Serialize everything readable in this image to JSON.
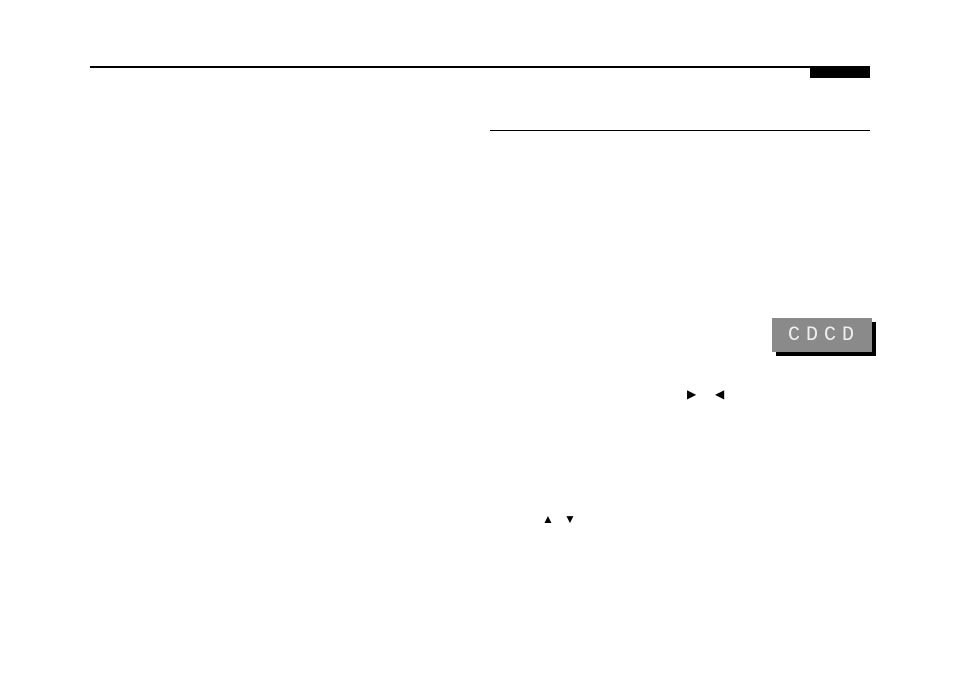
{
  "lcd": {
    "text": "CDCD"
  },
  "glyphs": {
    "right": "▶",
    "left": "◀",
    "up": "▲",
    "down": "▼"
  }
}
